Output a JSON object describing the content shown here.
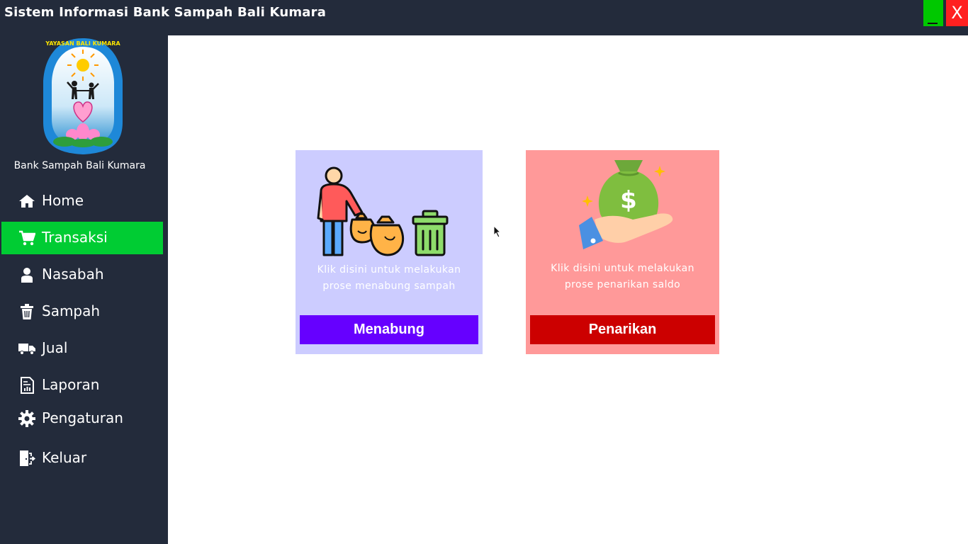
{
  "window": {
    "title": "Sistem Informasi Bank Sampah Bali Kumara",
    "minimize_icon": "minimize-icon",
    "close_label": "X"
  },
  "colors": {
    "background": "#232b3b",
    "active_nav": "#00cc33",
    "minimize": "#00c800",
    "close": "#ff2020",
    "menabung_card": "#ccccff",
    "menabung_button": "#6600ff",
    "penarikan_card": "#ff9999",
    "penarikan_button": "#cc0000"
  },
  "sidebar": {
    "logo_text": "YAYASAN BALI KUMARA",
    "org_name": "Bank Sampah Bali Kumara",
    "items": [
      {
        "label": "Home",
        "icon": "home-icon",
        "active": false
      },
      {
        "label": "Transaksi",
        "icon": "cart-icon",
        "active": true
      },
      {
        "label": "Nasabah",
        "icon": "user-icon",
        "active": false
      },
      {
        "label": "Sampah",
        "icon": "trash-icon",
        "active": false
      },
      {
        "label": "Jual",
        "icon": "truck-icon",
        "active": false
      },
      {
        "label": "Laporan",
        "icon": "report-icon",
        "active": false
      },
      {
        "label": "Pengaturan",
        "icon": "gear-icon",
        "active": false
      },
      {
        "label": "Keluar",
        "icon": "logout-icon",
        "active": false
      }
    ]
  },
  "main": {
    "menabung": {
      "illustration": "person-trash-bags-icon",
      "desc_line1": "Klik disini untuk melakukan",
      "desc_line2": "prose menabung sampah",
      "button_label": "Menabung"
    },
    "penarikan": {
      "illustration": "money-bag-hand-icon",
      "desc_line1": "Klik disini untuk melakukan",
      "desc_line2": "prose penarikan saldo",
      "button_label": "Penarikan"
    }
  }
}
